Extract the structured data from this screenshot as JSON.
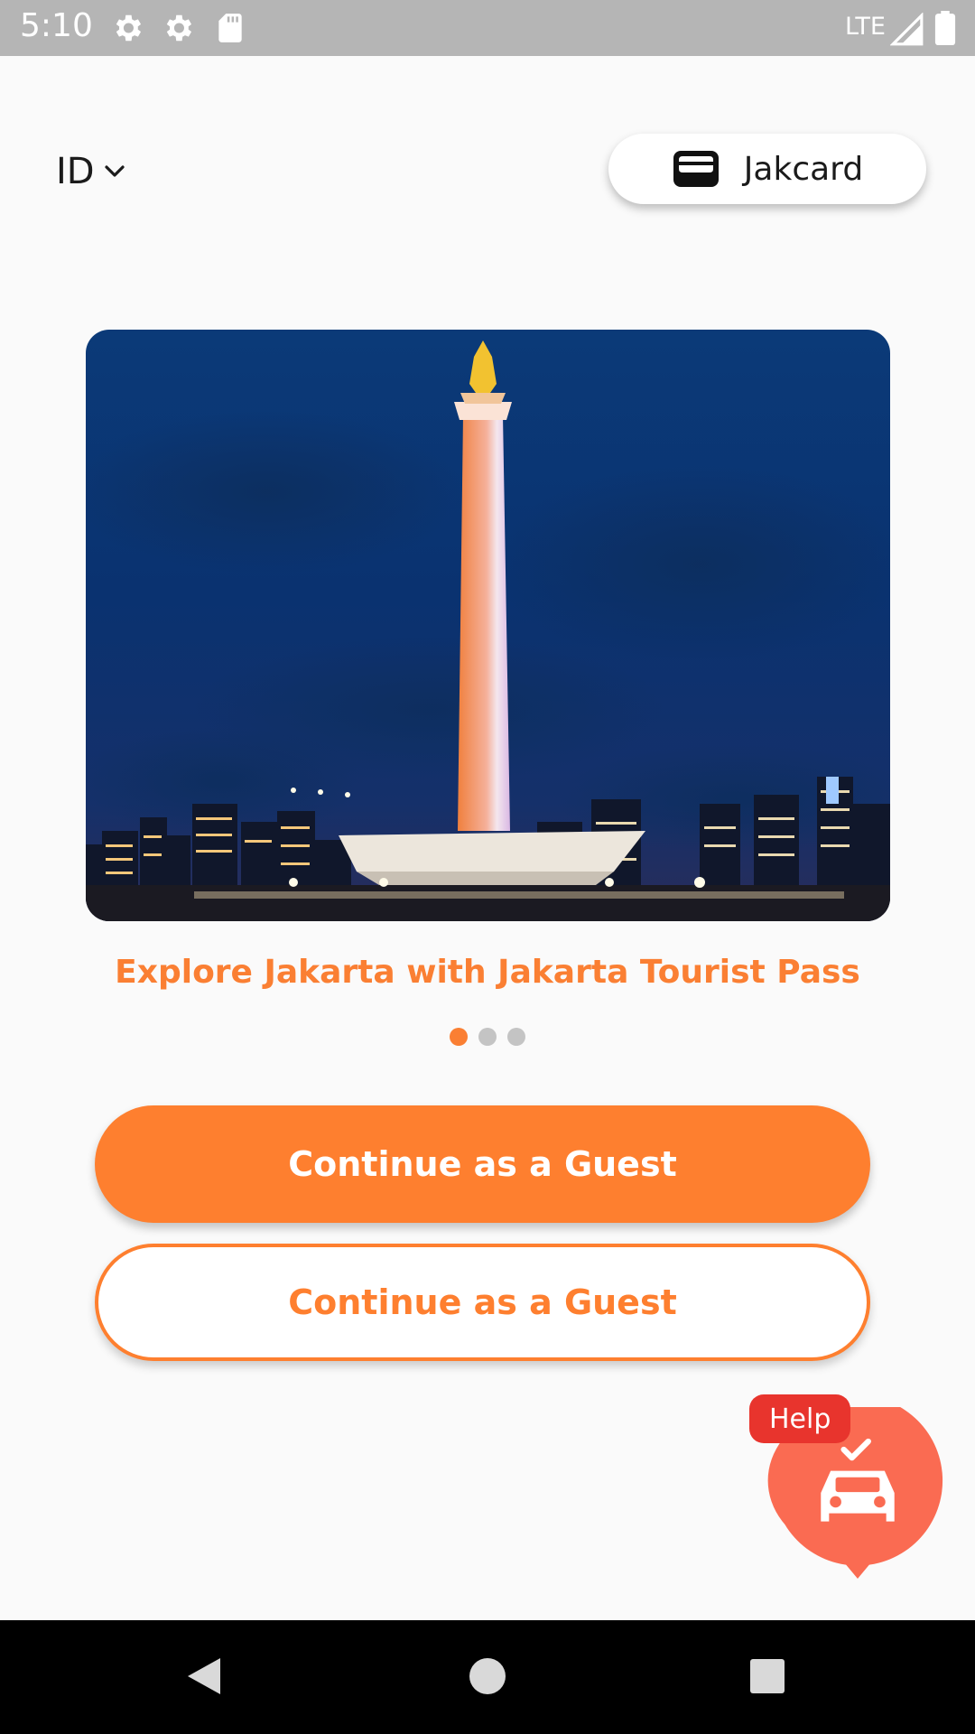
{
  "status_bar": {
    "time": "5:10",
    "network": "LTE",
    "icons": [
      "settings-icon",
      "settings-icon",
      "sd-card-icon",
      "signal-icon",
      "battery-icon"
    ]
  },
  "header": {
    "language": "ID",
    "jakcard_label": "Jakcard"
  },
  "carousel": {
    "caption": "Explore Jakarta with Jakarta Tourist Pass",
    "page_count": 3,
    "active_index": 0
  },
  "buttons": {
    "primary_label": "Continue as a Guest",
    "secondary_label": "Continue as a Guest"
  },
  "help": {
    "label": "Help"
  },
  "colors": {
    "accent": "#fe7f2f",
    "help_bubble": "#fa6b52",
    "help_badge": "#e8342d"
  },
  "nav_bar": {
    "icons": [
      "back-icon",
      "home-icon",
      "recents-icon"
    ]
  }
}
